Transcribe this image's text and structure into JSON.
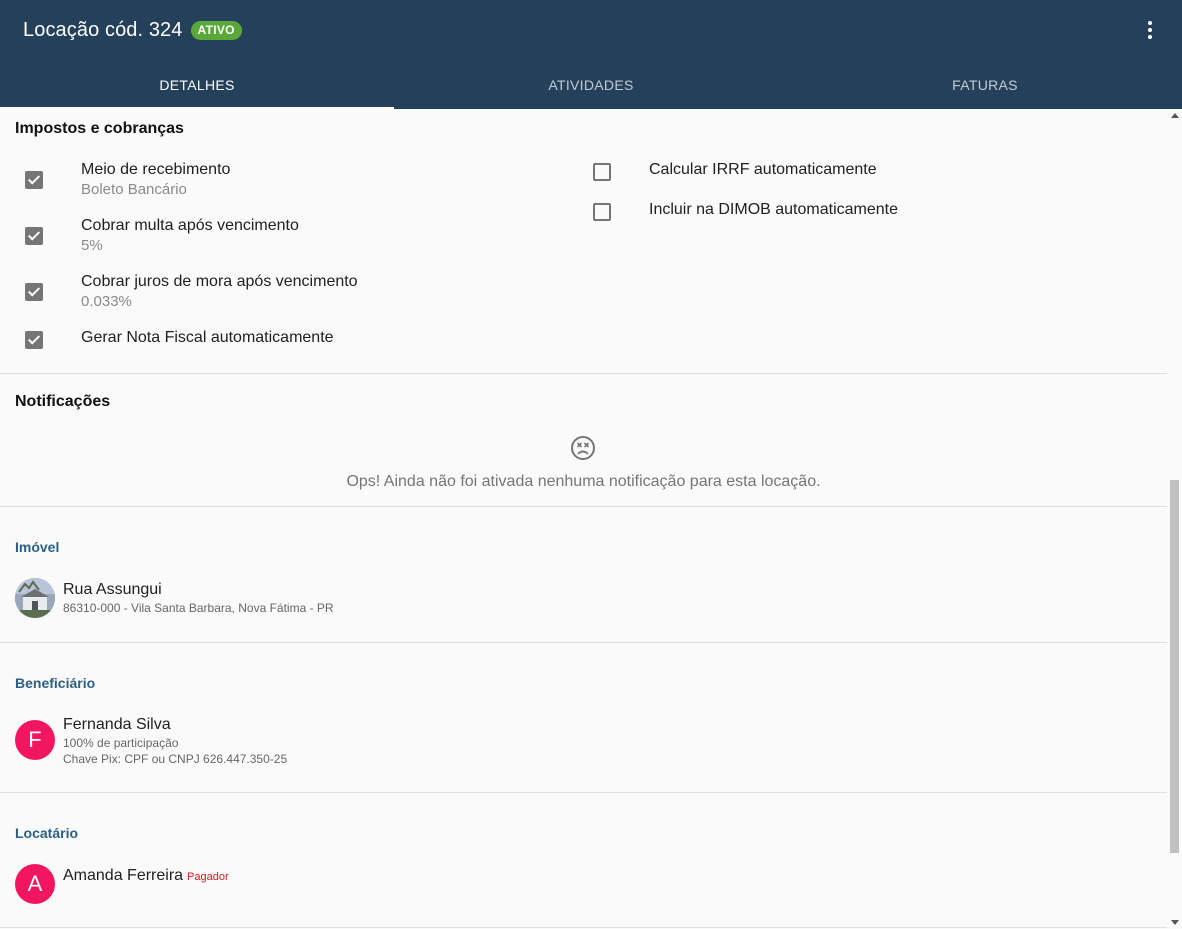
{
  "header": {
    "title": "Locação cód. 324",
    "status_badge": "ATIVO",
    "menu_icon": "more-vert-icon"
  },
  "tabs": [
    {
      "label": "DETALHES",
      "active": true
    },
    {
      "label": "ATIVIDADES",
      "active": false
    },
    {
      "label": "FATURAS",
      "active": false
    }
  ],
  "taxes": {
    "title": "Impostos e cobranças",
    "left_items": [
      {
        "label": "Meio de recebimento",
        "value": "Boleto Bancário",
        "checked": true
      },
      {
        "label": "Cobrar multa após vencimento",
        "value": "5%",
        "checked": true
      },
      {
        "label": "Cobrar juros de mora após vencimento",
        "value": "0.033%",
        "checked": true
      },
      {
        "label": "Gerar Nota Fiscal automaticamente",
        "value": "",
        "checked": true
      }
    ],
    "right_items": [
      {
        "label": "Calcular IRRF automaticamente",
        "checked": false
      },
      {
        "label": "Incluir na DIMOB automaticamente",
        "checked": false
      }
    ]
  },
  "notifications": {
    "title": "Notificações",
    "empty_icon": "sad-face-icon",
    "empty_message": "Ops! Ainda não foi ativada nenhuma notificação para esta locação."
  },
  "property": {
    "title": "Imóvel",
    "name": "Rua Assungui",
    "address": "86310-000 - Vila Santa Barbara, Nova Fátima - PR"
  },
  "beneficiary": {
    "title": "Beneficiário",
    "avatar_letter": "F",
    "name": "Fernanda Silva",
    "participation": "100% de participação",
    "pix": "Chave Pix: CPF ou CNPJ 626.447.350-25"
  },
  "tenant": {
    "title": "Locatário",
    "avatar_letter": "A",
    "name": "Amanda Ferreira",
    "tag": "Pagador"
  },
  "colors": {
    "appbar": "#25405a",
    "badge": "#5aa83a",
    "section_link": "#2b5f85",
    "avatar_pink": "#f21560",
    "pagador": "#e5141f"
  }
}
